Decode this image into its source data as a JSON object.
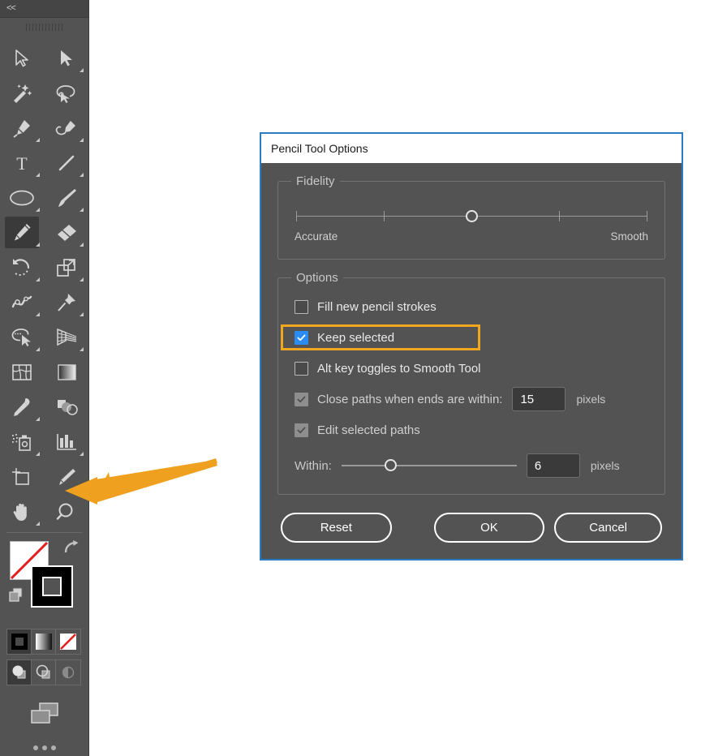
{
  "toolbar": {
    "collapse_label": "<<",
    "grip_name": "panel-drag-grip",
    "tools": [
      {
        "name": "selection-tool",
        "icon": "arrow-cursor",
        "selected": false,
        "has_flyout": false
      },
      {
        "name": "direct-selection-tool",
        "icon": "direct-select-arrow",
        "selected": false,
        "has_flyout": true
      },
      {
        "name": "magic-wand-tool",
        "icon": "magic-wand",
        "selected": false,
        "has_flyout": false
      },
      {
        "name": "lasso-tool",
        "icon": "lasso",
        "selected": false,
        "has_flyout": false
      },
      {
        "name": "pen-tool",
        "icon": "pen-nib",
        "selected": false,
        "has_flyout": true
      },
      {
        "name": "curvature-tool",
        "icon": "curvature-pen",
        "selected": false,
        "has_flyout": true
      },
      {
        "name": "type-tool",
        "icon": "text-T",
        "selected": false,
        "has_flyout": true
      },
      {
        "name": "line-segment-tool",
        "icon": "diagonal-line",
        "selected": false,
        "has_flyout": true
      },
      {
        "name": "ellipse-tool",
        "icon": "ellipse",
        "selected": false,
        "has_flyout": true
      },
      {
        "name": "paintbrush-tool",
        "icon": "paintbrush",
        "selected": false,
        "has_flyout": true
      },
      {
        "name": "pencil-tool",
        "icon": "pencil",
        "selected": true,
        "has_flyout": true
      },
      {
        "name": "eraser-tool",
        "icon": "eraser",
        "selected": false,
        "has_flyout": true
      },
      {
        "name": "rotate-tool",
        "icon": "rotate-arrow",
        "selected": false,
        "has_flyout": true
      },
      {
        "name": "scale-tool",
        "icon": "scale-squares",
        "selected": false,
        "has_flyout": true
      },
      {
        "name": "width-tool",
        "icon": "width-squiggle",
        "selected": false,
        "has_flyout": true
      },
      {
        "name": "free-transform-tool",
        "icon": "pushpin",
        "selected": false,
        "has_flyout": true
      },
      {
        "name": "shape-builder-tool",
        "icon": "shape-builder",
        "selected": false,
        "has_flyout": true
      },
      {
        "name": "perspective-grid-tool",
        "icon": "perspective-grid",
        "selected": false,
        "has_flyout": true
      },
      {
        "name": "mesh-tool",
        "icon": "mesh-grid",
        "selected": false,
        "has_flyout": false
      },
      {
        "name": "gradient-tool",
        "icon": "gradient-bar",
        "selected": false,
        "has_flyout": false
      },
      {
        "name": "eyedropper-tool",
        "icon": "eyedropper",
        "selected": false,
        "has_flyout": true
      },
      {
        "name": "blend-tool",
        "icon": "blend-shapes",
        "selected": false,
        "has_flyout": false
      },
      {
        "name": "symbol-sprayer-tool",
        "icon": "symbol-sprayer",
        "selected": false,
        "has_flyout": true
      },
      {
        "name": "column-graph-tool",
        "icon": "bar-chart",
        "selected": false,
        "has_flyout": true
      },
      {
        "name": "artboard-tool",
        "icon": "artboard",
        "selected": false,
        "has_flyout": false
      },
      {
        "name": "slice-tool",
        "icon": "slice-knife",
        "selected": false,
        "has_flyout": true
      },
      {
        "name": "hand-tool",
        "icon": "hand",
        "selected": false,
        "has_flyout": true
      },
      {
        "name": "zoom-tool",
        "icon": "magnifier",
        "selected": false,
        "has_flyout": false
      }
    ],
    "swatches": {
      "fill_name": "fill-color-swatch",
      "fill_color": "#ffffff",
      "fill_is_none": true,
      "stroke_name": "stroke-color-swatch",
      "stroke_color": "#000000",
      "swap_name": "swap-fill-stroke-icon",
      "default_name": "default-fill-stroke-icon"
    },
    "paint_modes": [
      {
        "name": "color-mode-button",
        "icon": "solid-color",
        "active": true
      },
      {
        "name": "gradient-mode-button",
        "icon": "gradient",
        "active": false
      },
      {
        "name": "none-mode-button",
        "icon": "none-slash",
        "active": false
      }
    ],
    "draw_modes": [
      {
        "name": "draw-normal-button",
        "icon": "draw-normal",
        "active": true
      },
      {
        "name": "draw-behind-button",
        "icon": "draw-behind",
        "active": false
      },
      {
        "name": "draw-inside-button",
        "icon": "draw-inside",
        "active": false
      }
    ],
    "screen_mode": {
      "name": "change-screen-mode-button",
      "icon": "screen-mode"
    },
    "more_tools": {
      "name": "edit-toolbar-button",
      "icon": "ellipsis"
    }
  },
  "annotation": {
    "arrow_name": "orange-callout-arrow",
    "arrow_color": "#efa01e",
    "highlight_color": "#f0a61e",
    "highlight_target": "keep-selected-row"
  },
  "dialog": {
    "title": "Pencil Tool Options",
    "border_color": "#2a7ac4",
    "fidelity": {
      "group_label": "Fidelity",
      "min_label": "Accurate",
      "max_label": "Smooth",
      "tick_count": 5,
      "value_index": 2,
      "value_percent": 50
    },
    "options": {
      "group_label": "Options",
      "items": [
        {
          "name": "fill-new-pencil-strokes",
          "label": "Fill new pencil strokes",
          "checked": false,
          "state": "unchecked",
          "highlighted": false
        },
        {
          "name": "keep-selected",
          "label": "Keep selected",
          "checked": true,
          "state": "checked-blue",
          "highlighted": true
        },
        {
          "name": "alt-key-toggles-smooth-tool",
          "label": "Alt key toggles to Smooth Tool",
          "checked": false,
          "state": "unchecked",
          "highlighted": false
        },
        {
          "name": "close-paths-when-ends-within",
          "label": "Close paths when ends are within:",
          "checked": true,
          "state": "checked-gray",
          "highlighted": false,
          "value": "15",
          "units": "pixels"
        },
        {
          "name": "edit-selected-paths",
          "label": "Edit selected paths",
          "checked": true,
          "state": "checked-gray",
          "highlighted": false
        }
      ],
      "within": {
        "label": "Within:",
        "value": "6",
        "units": "pixels",
        "slider_percent": 28
      }
    },
    "buttons": {
      "reset": "Reset",
      "ok": "OK",
      "cancel": "Cancel"
    }
  }
}
